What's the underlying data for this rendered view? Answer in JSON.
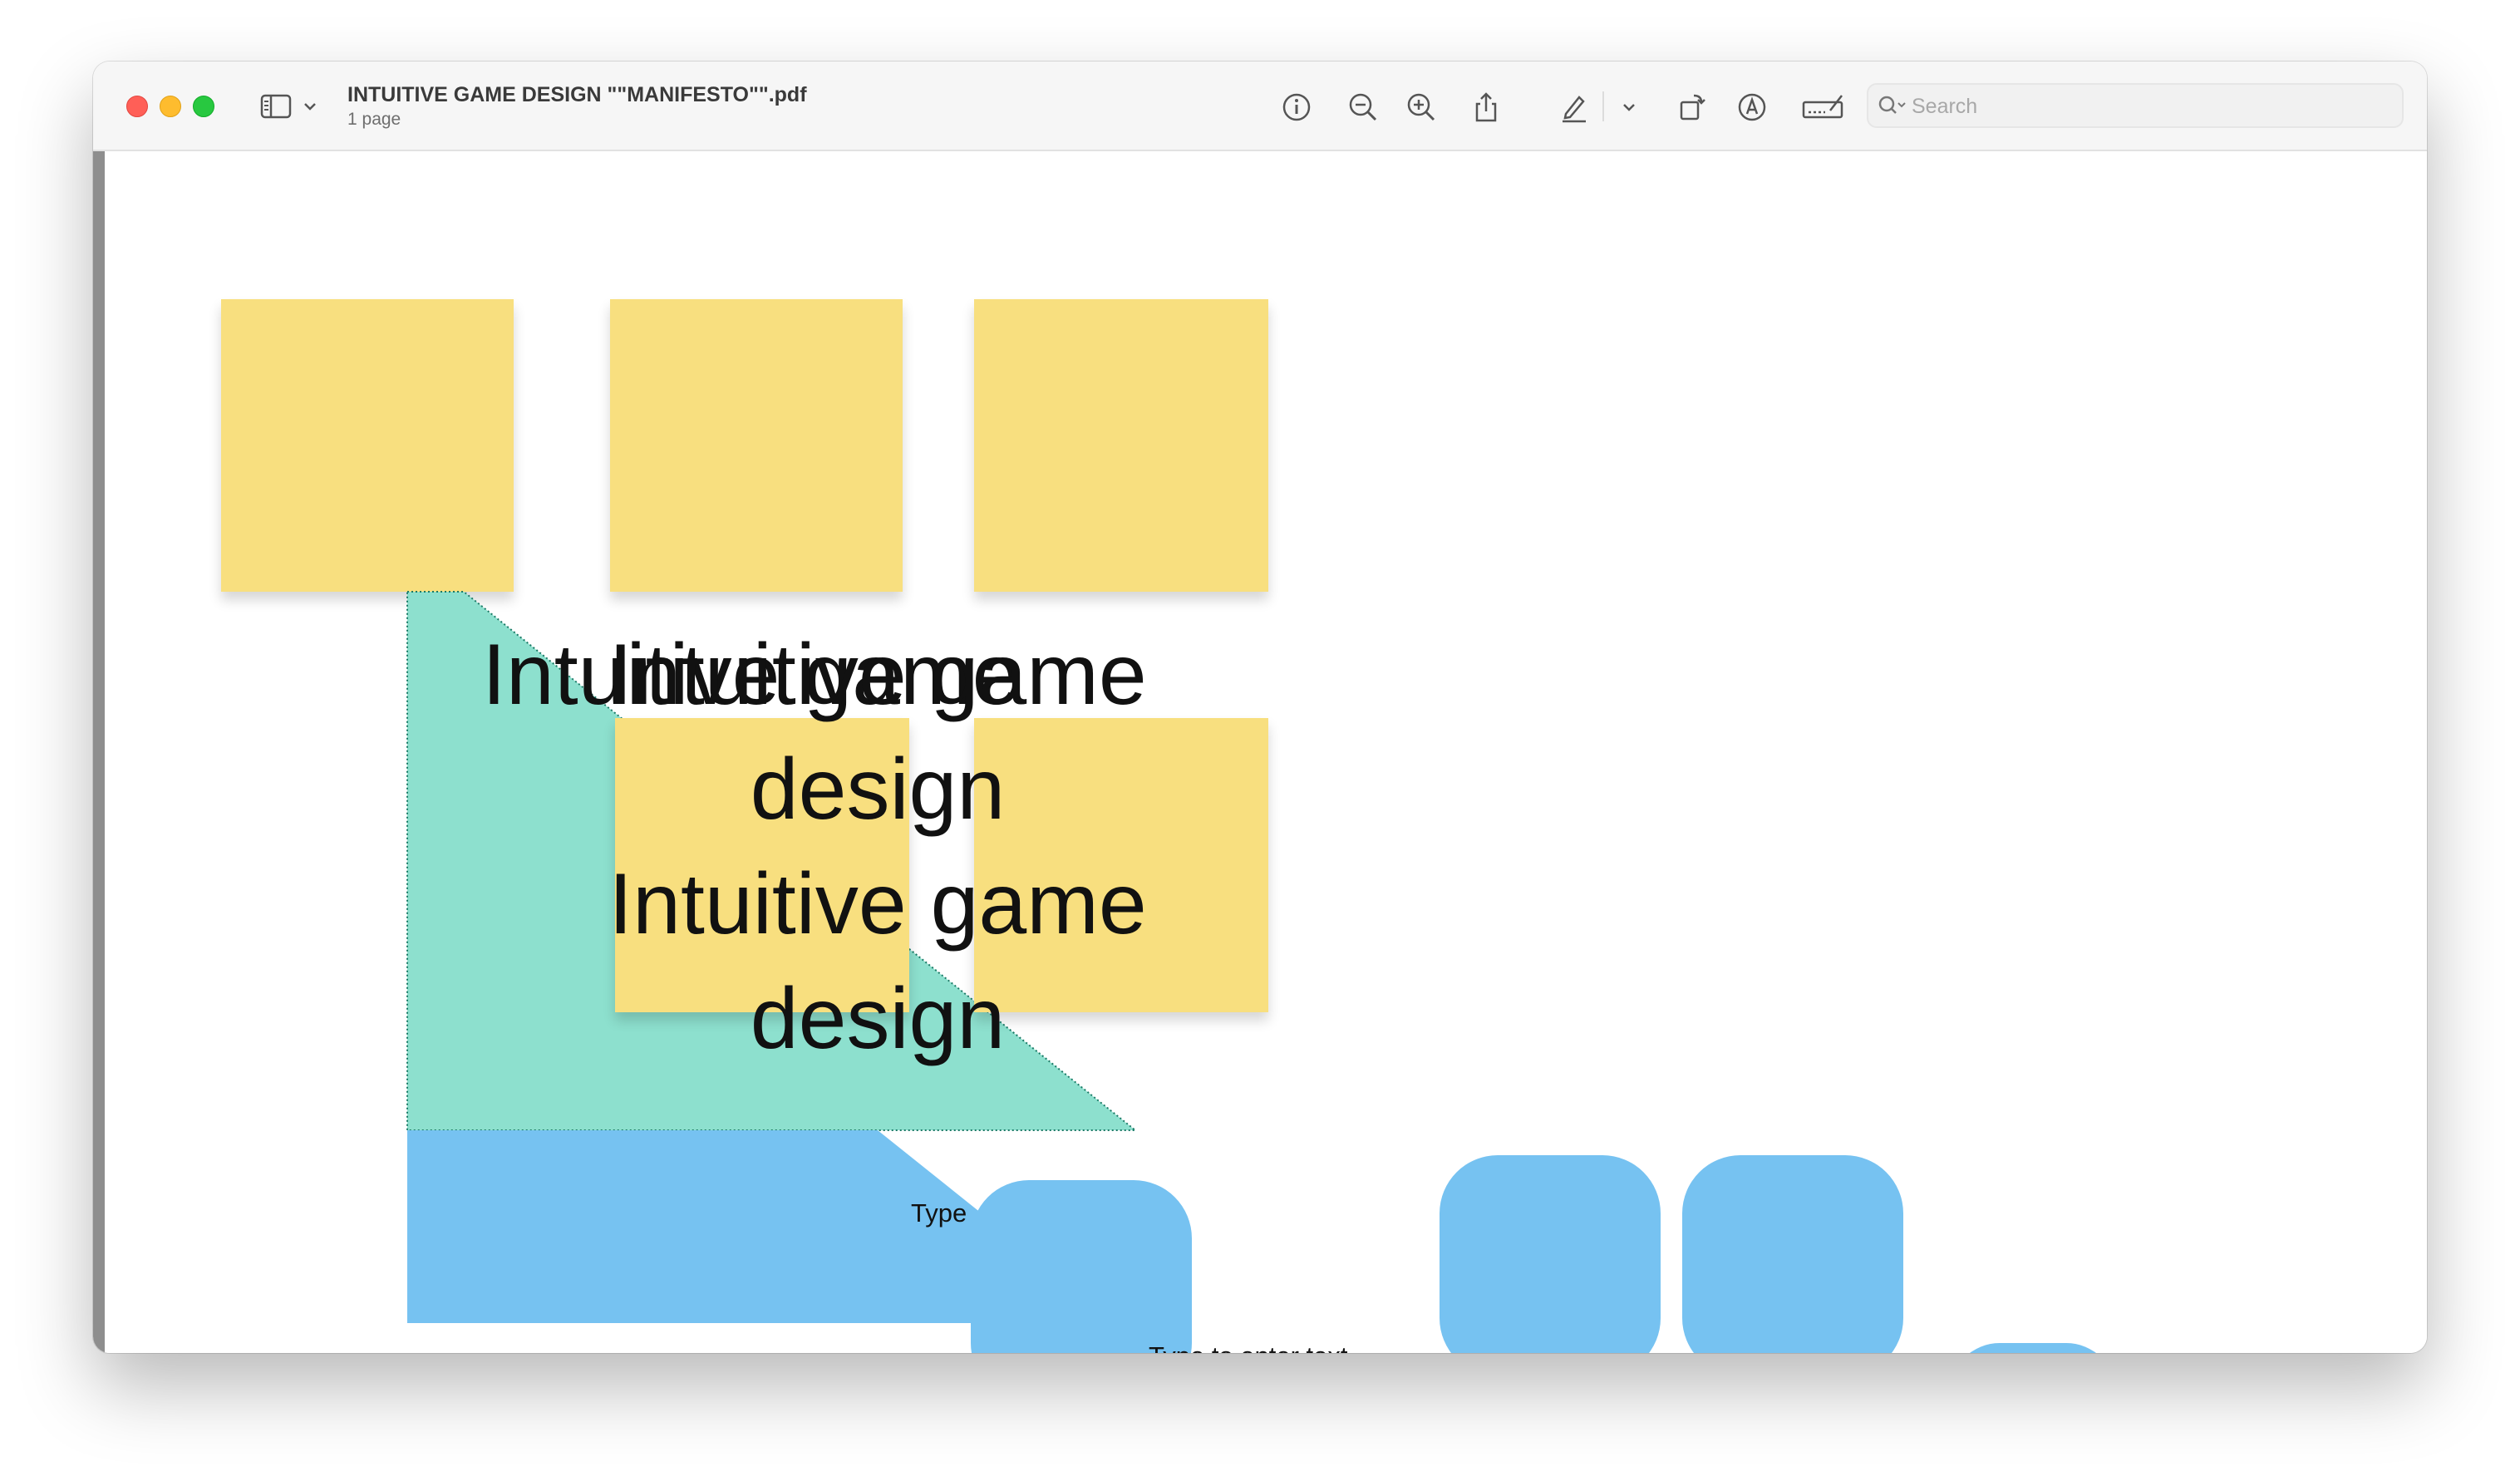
{
  "window": {
    "doc_title": "INTUITIVE GAME DESIGN \"\"MANIFESTO\"\".pdf",
    "doc_subtitle": "1 page"
  },
  "toolbar": {
    "icons": [
      "sidebar-icon",
      "chevron-down-icon",
      "info-icon",
      "zoom-out-icon",
      "zoom-in-icon",
      "share-icon",
      "highlight-pen-icon",
      "chevron-down-icon",
      "rotate-icon",
      "markup-icon",
      "signature-icon",
      "search-icon"
    ],
    "search_placeholder": "Search"
  },
  "document": {
    "overlapping_title": "Intuitive game",
    "title_line_1": "Intuitive game",
    "title_line_2": "design",
    "title_line_3": "Intuitive game",
    "title_line_4": "design",
    "clipped_placeholder": "Type t",
    "placeholder": "Type to enter text"
  },
  "colors": {
    "sticky_yellow": "#f8df7f",
    "teal_shape": "#8de0ce",
    "blue_shape": "#76c2f1",
    "close": "#ff5f57",
    "minimize": "#febc2e",
    "maximize": "#28c840"
  }
}
